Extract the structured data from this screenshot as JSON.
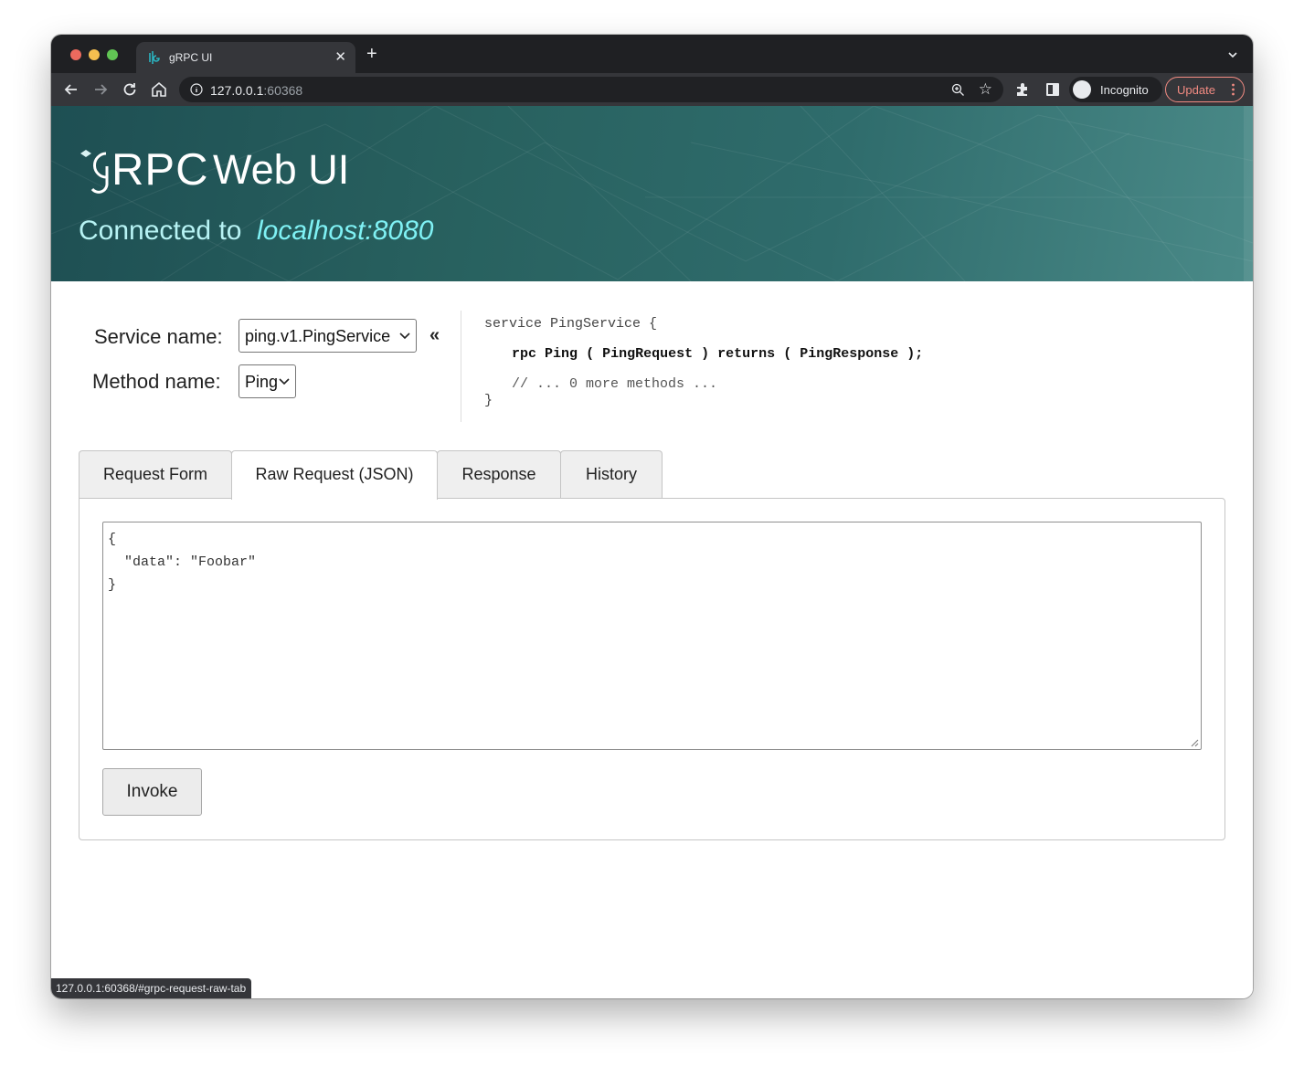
{
  "browser": {
    "tab_title": "gRPC UI",
    "url_host": "127.0.0.1",
    "url_port": ":60368",
    "profile_label": "Incognito",
    "update_label": "Update",
    "status_url": "127.0.0.1:60368/#grpc-request-raw-tab"
  },
  "header": {
    "logo_text": "RPC",
    "title": "Web UI",
    "connected_label": "Connected to",
    "connected_host": "localhost:8080"
  },
  "selectors": {
    "service_label": "Service name:",
    "service_value": "ping.v1.PingService",
    "method_label": "Method name:",
    "method_value": "Ping",
    "collapse_symbol": "«"
  },
  "schema": {
    "line1": "service PingService {",
    "rpc_kw": "rpc",
    "method": "Ping",
    "paren_open_1": "(",
    "request_type": "PingRequest",
    "paren_close_1": ")",
    "returns_kw": "returns",
    "paren_open_2": "(",
    "response_type": "PingResponse",
    "close": ");",
    "comment": "// ... 0 more methods ...",
    "line_end": "}"
  },
  "tabs": [
    "Request Form",
    "Raw Request (JSON)",
    "Response",
    "History"
  ],
  "active_tab": 1,
  "raw_request": "{\n  \"data\": \"Foobar\"\n}",
  "invoke_label": "Invoke",
  "colors": {
    "hero_start": "#1e4f53",
    "hero_end": "#4a8a88",
    "host_accent": "#7ff1f4",
    "update_accent": "#f28b82"
  }
}
